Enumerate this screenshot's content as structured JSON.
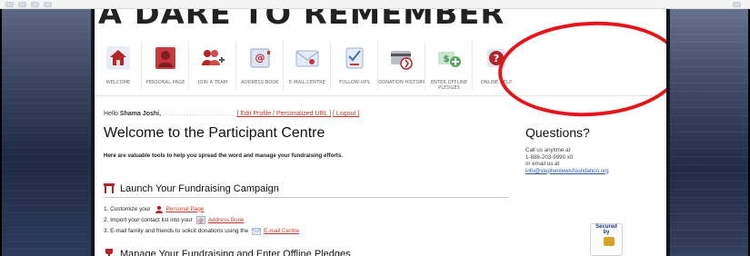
{
  "site_title": "A DARE TO REMEMBER",
  "nav": [
    {
      "label": "Welcome",
      "icon": "house-icon"
    },
    {
      "label": "Personal Page",
      "icon": "person-icon"
    },
    {
      "label": "Join a Team",
      "icon": "team-icon"
    },
    {
      "label": "Address Book",
      "icon": "address-book-icon"
    },
    {
      "label": "E-Mail Centre",
      "icon": "email-icon"
    },
    {
      "label": "Follow-Ups",
      "icon": "checklist-icon"
    },
    {
      "label": "Donation History",
      "icon": "credit-card-icon"
    },
    {
      "label": "Enter Offline Pledges",
      "icon": "money-plus-icon"
    },
    {
      "label": "Online Help",
      "icon": "help-icon"
    }
  ],
  "greeting": {
    "hello": "Hello",
    "name": "Shama Joshi,",
    "dots": "...........................",
    "edit_link": "[ Edit Profile / Personalized URL ]",
    "logout_link": "[ Logout ]"
  },
  "main": {
    "title": "Welcome to the Participant Centre",
    "intro": "Here are valuable tools to help you spread the word and manage your fundraising efforts.",
    "section1": "Launch Your Fundraising Campaign",
    "steps": [
      {
        "num": "1.",
        "text": "Customize your",
        "link": "Personal Page"
      },
      {
        "num": "2.",
        "text": "Import your contact list into your",
        "link": "Address Book"
      },
      {
        "num": "3.",
        "text": "E-mail family and friends to solicit donations using the",
        "link": "E-mail Centre"
      }
    ],
    "section2": "Manage Your Fundraising and Enter Offline Pledges"
  },
  "questions": {
    "title": "Questions?",
    "line1": "Call us anytime at",
    "phone": "1-888-203-9990 x0",
    "line2": "or email us at",
    "email": "info@stephenlewisfoundation.org"
  },
  "badge": {
    "line1": "Secured",
    "line2": "by"
  },
  "colors": {
    "highlight": "#e4161b",
    "link": "#c0392b",
    "email_link": "#2b55a5"
  }
}
